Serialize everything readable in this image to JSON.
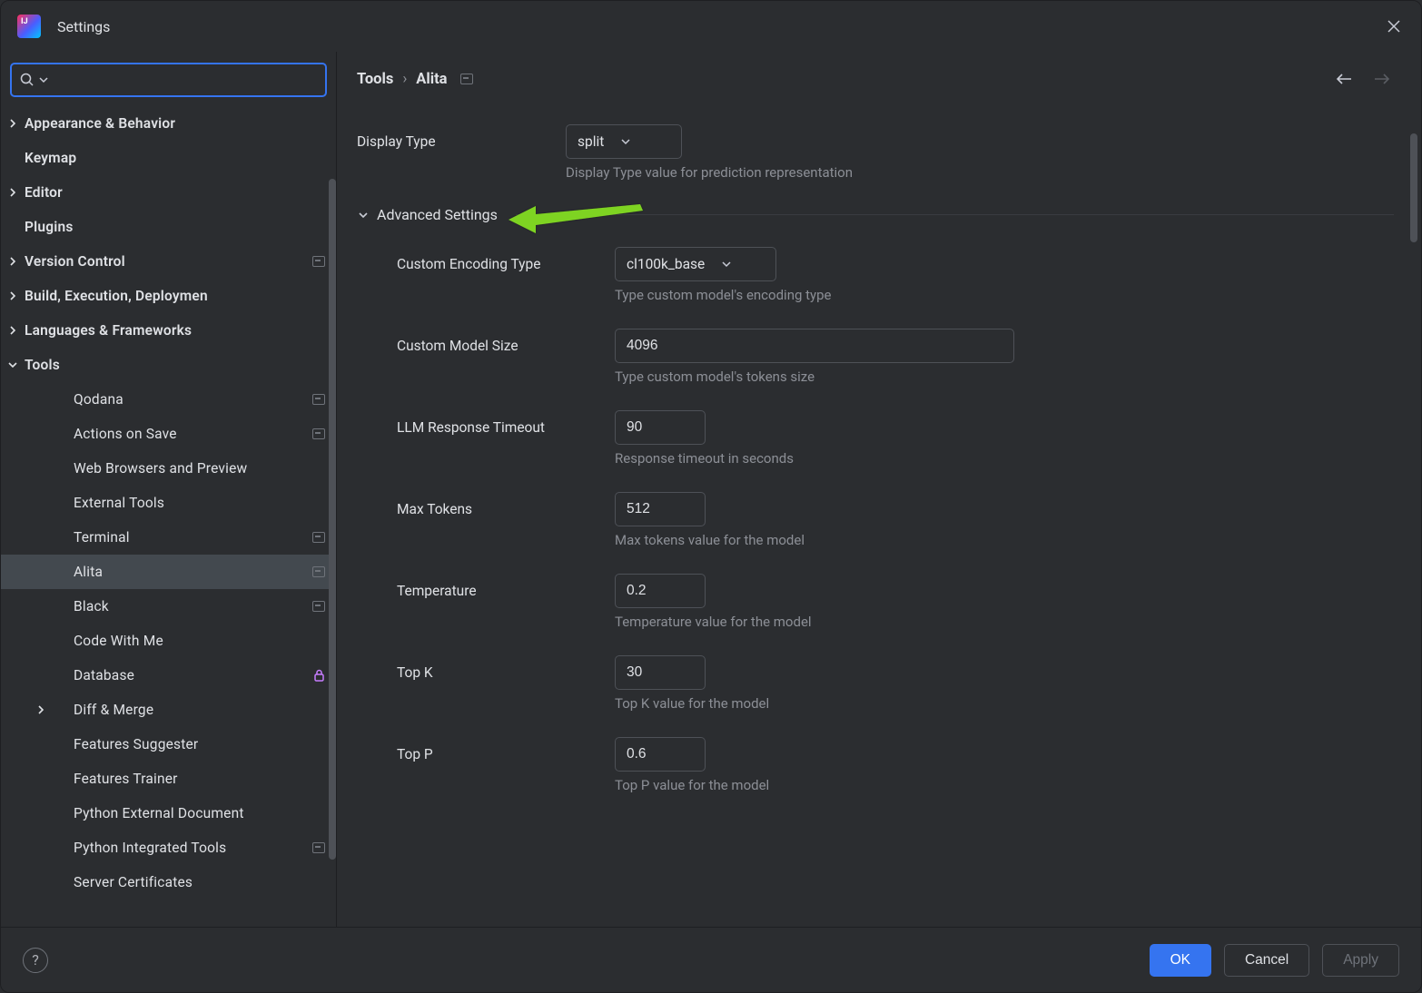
{
  "window": {
    "title": "Settings"
  },
  "search": {
    "value": ""
  },
  "breadcrumb": {
    "root": "Tools",
    "current": "Alita"
  },
  "sidebar": {
    "items": [
      {
        "label": "Appearance & Behavior",
        "expandable": true,
        "expanded": false,
        "level": 0
      },
      {
        "label": "Keymap",
        "expandable": false,
        "level": 0
      },
      {
        "label": "Editor",
        "expandable": true,
        "expanded": false,
        "level": 0
      },
      {
        "label": "Plugins",
        "expandable": false,
        "level": 0
      },
      {
        "label": "Version Control",
        "expandable": true,
        "expanded": false,
        "level": 0,
        "badge": true
      },
      {
        "label": "Build, Execution, Deployment",
        "expandable": true,
        "expanded": false,
        "level": 0,
        "truncate": true
      },
      {
        "label": "Languages & Frameworks",
        "expandable": true,
        "expanded": false,
        "level": 0
      },
      {
        "label": "Tools",
        "expandable": true,
        "expanded": true,
        "level": 0
      },
      {
        "label": "Qodana",
        "level": 1,
        "badge": true
      },
      {
        "label": "Actions on Save",
        "level": 1,
        "badge": true
      },
      {
        "label": "Web Browsers and Preview",
        "level": 1
      },
      {
        "label": "External Tools",
        "level": 1
      },
      {
        "label": "Terminal",
        "level": 1,
        "badge": true
      },
      {
        "label": "Alita",
        "level": 1,
        "selected": true,
        "badge": true
      },
      {
        "label": "Black",
        "level": 1,
        "badge": true
      },
      {
        "label": "Code With Me",
        "level": 1
      },
      {
        "label": "Database",
        "level": 1,
        "lock": true
      },
      {
        "label": "Diff & Merge",
        "level": 1,
        "expandable": true,
        "expanded": false,
        "arrowLevel": 1
      },
      {
        "label": "Features Suggester",
        "level": 1
      },
      {
        "label": "Features Trainer",
        "level": 1
      },
      {
        "label": "Python External Documentation",
        "level": 1,
        "truncate": true
      },
      {
        "label": "Python Integrated Tools",
        "level": 1,
        "badge": true
      },
      {
        "label": "Server Certificates",
        "level": 1
      }
    ]
  },
  "form": {
    "display_type": {
      "label": "Display Type",
      "value": "split",
      "help": "Display Type value for prediction representation"
    },
    "section": "Advanced Settings",
    "encoding": {
      "label": "Custom Encoding Type",
      "value": "cl100k_base",
      "help": "Type custom model's encoding type"
    },
    "model_size": {
      "label": "Custom Model Size",
      "value": "4096",
      "help": "Type custom model's tokens size"
    },
    "timeout": {
      "label": "LLM Response Timeout",
      "value": "90",
      "help": "Response timeout in seconds"
    },
    "max_tokens": {
      "label": "Max Tokens",
      "value": "512",
      "help": "Max tokens value for the model"
    },
    "temperature": {
      "label": "Temperature",
      "value": "0.2",
      "help": "Temperature value for the model"
    },
    "top_k": {
      "label": "Top K",
      "value": "30",
      "help": "Top K value for the model"
    },
    "top_p": {
      "label": "Top P",
      "value": "0.6",
      "help": "Top P value for the model"
    }
  },
  "buttons": {
    "ok": "OK",
    "cancel": "Cancel",
    "apply": "Apply",
    "help": "?"
  }
}
